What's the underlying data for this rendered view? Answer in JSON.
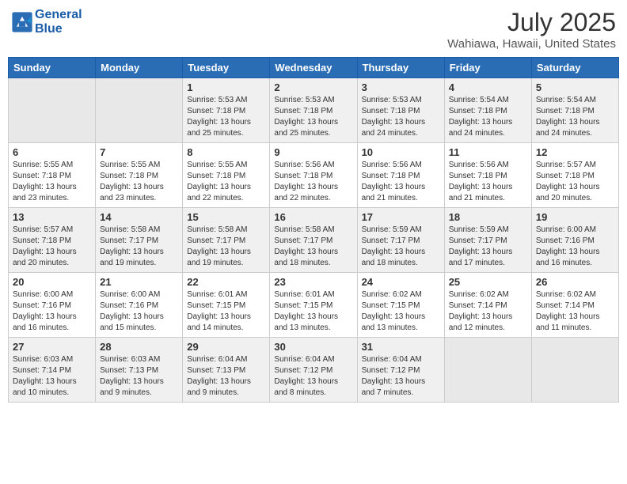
{
  "header": {
    "logo_line1": "General",
    "logo_line2": "Blue",
    "month": "July 2025",
    "location": "Wahiawa, Hawaii, United States"
  },
  "days_of_week": [
    "Sunday",
    "Monday",
    "Tuesday",
    "Wednesday",
    "Thursday",
    "Friday",
    "Saturday"
  ],
  "weeks": [
    [
      {
        "day": "",
        "sunrise": "",
        "sunset": "",
        "daylight": ""
      },
      {
        "day": "",
        "sunrise": "",
        "sunset": "",
        "daylight": ""
      },
      {
        "day": "1",
        "sunrise": "Sunrise: 5:53 AM",
        "sunset": "Sunset: 7:18 PM",
        "daylight": "Daylight: 13 hours and 25 minutes."
      },
      {
        "day": "2",
        "sunrise": "Sunrise: 5:53 AM",
        "sunset": "Sunset: 7:18 PM",
        "daylight": "Daylight: 13 hours and 25 minutes."
      },
      {
        "day": "3",
        "sunrise": "Sunrise: 5:53 AM",
        "sunset": "Sunset: 7:18 PM",
        "daylight": "Daylight: 13 hours and 24 minutes."
      },
      {
        "day": "4",
        "sunrise": "Sunrise: 5:54 AM",
        "sunset": "Sunset: 7:18 PM",
        "daylight": "Daylight: 13 hours and 24 minutes."
      },
      {
        "day": "5",
        "sunrise": "Sunrise: 5:54 AM",
        "sunset": "Sunset: 7:18 PM",
        "daylight": "Daylight: 13 hours and 24 minutes."
      }
    ],
    [
      {
        "day": "6",
        "sunrise": "Sunrise: 5:55 AM",
        "sunset": "Sunset: 7:18 PM",
        "daylight": "Daylight: 13 hours and 23 minutes."
      },
      {
        "day": "7",
        "sunrise": "Sunrise: 5:55 AM",
        "sunset": "Sunset: 7:18 PM",
        "daylight": "Daylight: 13 hours and 23 minutes."
      },
      {
        "day": "8",
        "sunrise": "Sunrise: 5:55 AM",
        "sunset": "Sunset: 7:18 PM",
        "daylight": "Daylight: 13 hours and 22 minutes."
      },
      {
        "day": "9",
        "sunrise": "Sunrise: 5:56 AM",
        "sunset": "Sunset: 7:18 PM",
        "daylight": "Daylight: 13 hours and 22 minutes."
      },
      {
        "day": "10",
        "sunrise": "Sunrise: 5:56 AM",
        "sunset": "Sunset: 7:18 PM",
        "daylight": "Daylight: 13 hours and 21 minutes."
      },
      {
        "day": "11",
        "sunrise": "Sunrise: 5:56 AM",
        "sunset": "Sunset: 7:18 PM",
        "daylight": "Daylight: 13 hours and 21 minutes."
      },
      {
        "day": "12",
        "sunrise": "Sunrise: 5:57 AM",
        "sunset": "Sunset: 7:18 PM",
        "daylight": "Daylight: 13 hours and 20 minutes."
      }
    ],
    [
      {
        "day": "13",
        "sunrise": "Sunrise: 5:57 AM",
        "sunset": "Sunset: 7:18 PM",
        "daylight": "Daylight: 13 hours and 20 minutes."
      },
      {
        "day": "14",
        "sunrise": "Sunrise: 5:58 AM",
        "sunset": "Sunset: 7:17 PM",
        "daylight": "Daylight: 13 hours and 19 minutes."
      },
      {
        "day": "15",
        "sunrise": "Sunrise: 5:58 AM",
        "sunset": "Sunset: 7:17 PM",
        "daylight": "Daylight: 13 hours and 19 minutes."
      },
      {
        "day": "16",
        "sunrise": "Sunrise: 5:58 AM",
        "sunset": "Sunset: 7:17 PM",
        "daylight": "Daylight: 13 hours and 18 minutes."
      },
      {
        "day": "17",
        "sunrise": "Sunrise: 5:59 AM",
        "sunset": "Sunset: 7:17 PM",
        "daylight": "Daylight: 13 hours and 18 minutes."
      },
      {
        "day": "18",
        "sunrise": "Sunrise: 5:59 AM",
        "sunset": "Sunset: 7:17 PM",
        "daylight": "Daylight: 13 hours and 17 minutes."
      },
      {
        "day": "19",
        "sunrise": "Sunrise: 6:00 AM",
        "sunset": "Sunset: 7:16 PM",
        "daylight": "Daylight: 13 hours and 16 minutes."
      }
    ],
    [
      {
        "day": "20",
        "sunrise": "Sunrise: 6:00 AM",
        "sunset": "Sunset: 7:16 PM",
        "daylight": "Daylight: 13 hours and 16 minutes."
      },
      {
        "day": "21",
        "sunrise": "Sunrise: 6:00 AM",
        "sunset": "Sunset: 7:16 PM",
        "daylight": "Daylight: 13 hours and 15 minutes."
      },
      {
        "day": "22",
        "sunrise": "Sunrise: 6:01 AM",
        "sunset": "Sunset: 7:15 PM",
        "daylight": "Daylight: 13 hours and 14 minutes."
      },
      {
        "day": "23",
        "sunrise": "Sunrise: 6:01 AM",
        "sunset": "Sunset: 7:15 PM",
        "daylight": "Daylight: 13 hours and 13 minutes."
      },
      {
        "day": "24",
        "sunrise": "Sunrise: 6:02 AM",
        "sunset": "Sunset: 7:15 PM",
        "daylight": "Daylight: 13 hours and 13 minutes."
      },
      {
        "day": "25",
        "sunrise": "Sunrise: 6:02 AM",
        "sunset": "Sunset: 7:14 PM",
        "daylight": "Daylight: 13 hours and 12 minutes."
      },
      {
        "day": "26",
        "sunrise": "Sunrise: 6:02 AM",
        "sunset": "Sunset: 7:14 PM",
        "daylight": "Daylight: 13 hours and 11 minutes."
      }
    ],
    [
      {
        "day": "27",
        "sunrise": "Sunrise: 6:03 AM",
        "sunset": "Sunset: 7:14 PM",
        "daylight": "Daylight: 13 hours and 10 minutes."
      },
      {
        "day": "28",
        "sunrise": "Sunrise: 6:03 AM",
        "sunset": "Sunset: 7:13 PM",
        "daylight": "Daylight: 13 hours and 9 minutes."
      },
      {
        "day": "29",
        "sunrise": "Sunrise: 6:04 AM",
        "sunset": "Sunset: 7:13 PM",
        "daylight": "Daylight: 13 hours and 9 minutes."
      },
      {
        "day": "30",
        "sunrise": "Sunrise: 6:04 AM",
        "sunset": "Sunset: 7:12 PM",
        "daylight": "Daylight: 13 hours and 8 minutes."
      },
      {
        "day": "31",
        "sunrise": "Sunrise: 6:04 AM",
        "sunset": "Sunset: 7:12 PM",
        "daylight": "Daylight: 13 hours and 7 minutes."
      },
      {
        "day": "",
        "sunrise": "",
        "sunset": "",
        "daylight": ""
      },
      {
        "day": "",
        "sunrise": "",
        "sunset": "",
        "daylight": ""
      }
    ]
  ]
}
